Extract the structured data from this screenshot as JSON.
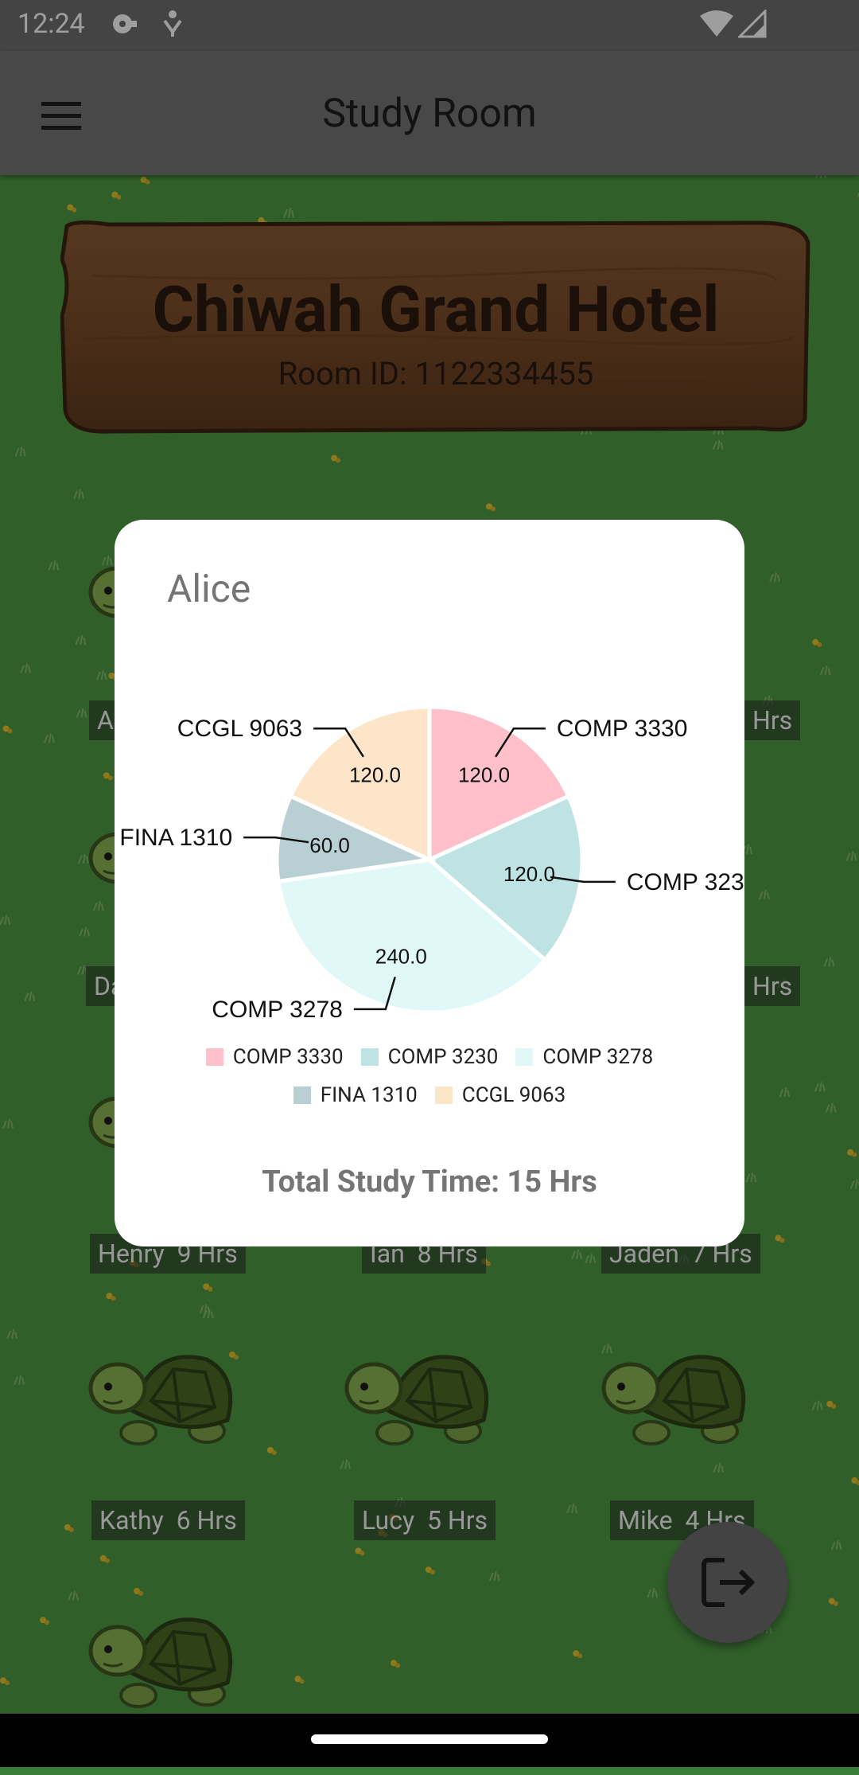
{
  "status": {
    "time": "12:24"
  },
  "appbar": {
    "title": "Study Room"
  },
  "room": {
    "name": "Chiwah Grand Hotel",
    "room_id": "Room ID: 1122334455"
  },
  "members": [
    {
      "name": "Henry",
      "hours": "9 Hrs"
    },
    {
      "name": "Ian",
      "hours": "8 Hrs"
    },
    {
      "name": "Jaden",
      "hours": "7 Hrs"
    },
    {
      "name": "Kathy",
      "hours": "6 Hrs"
    },
    {
      "name": "Lucy",
      "hours": "5 Hrs"
    },
    {
      "name": "Mike",
      "hours": "4 Hrs"
    }
  ],
  "partial_labels": {
    "row1_left": "A",
    "row1_right": "Hrs",
    "row2_left": "Da",
    "row2_right": "Hrs"
  },
  "dialog": {
    "user": "Alice",
    "total": "Total Study Time: 15 Hrs"
  },
  "chart_data": {
    "type": "pie",
    "categories": [
      "COMP 3330",
      "COMP 3230",
      "COMP 3278",
      "FINA 1310",
      "CCGL 9063"
    ],
    "values": [
      120.0,
      120.0,
      240.0,
      60.0,
      120.0
    ],
    "value_labels": [
      "120.0",
      "120.0",
      "240.0",
      "60.0",
      "120.0"
    ],
    "colors": [
      "#ffc0cb",
      "#bfe3e3",
      "#e0f8f8",
      "#b8cfd4",
      "#fde5c9"
    ],
    "legend_position": "bottom"
  }
}
